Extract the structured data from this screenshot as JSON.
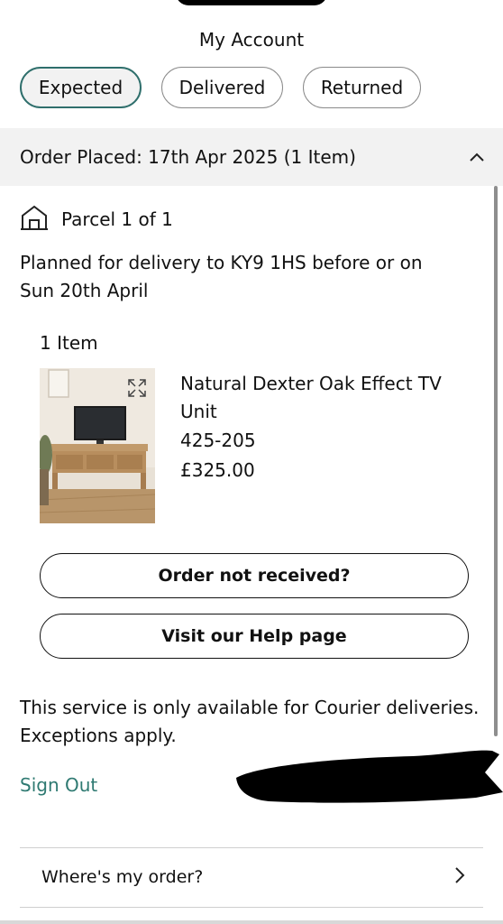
{
  "header": {
    "title": "My Account"
  },
  "tabs": [
    {
      "label": "Expected",
      "active": true
    },
    {
      "label": "Delivered",
      "active": false
    },
    {
      "label": "Returned",
      "active": false
    }
  ],
  "order": {
    "header": "Order Placed: 17th Apr 2025 (1 Item)",
    "expanded_icon": "chevron-up-icon",
    "parcel": {
      "icon": "house-icon",
      "label": "Parcel 1 of 1",
      "delivery_note": "Planned for delivery to KY9 1HS before or on Sun 20th April"
    },
    "item_count": "1 Item",
    "product": {
      "name": "Natural Dexter Oak Effect TV Unit",
      "code": "425-205",
      "price": "£325.00",
      "expand_icon": "expand-icon"
    }
  },
  "actions": {
    "not_received": "Order not received?",
    "help_page": "Visit our Help page"
  },
  "service_note": "This service is only available for Courier deliveries. Exceptions apply.",
  "sign_out": "Sign Out",
  "links": {
    "wheres_my_order": "Where's my order?",
    "chevron": "chevron-right-icon"
  },
  "colors": {
    "accent_teal": "#2f6f6c",
    "sign_out": "#2f7a72",
    "section_bg": "#f2f2f2"
  }
}
